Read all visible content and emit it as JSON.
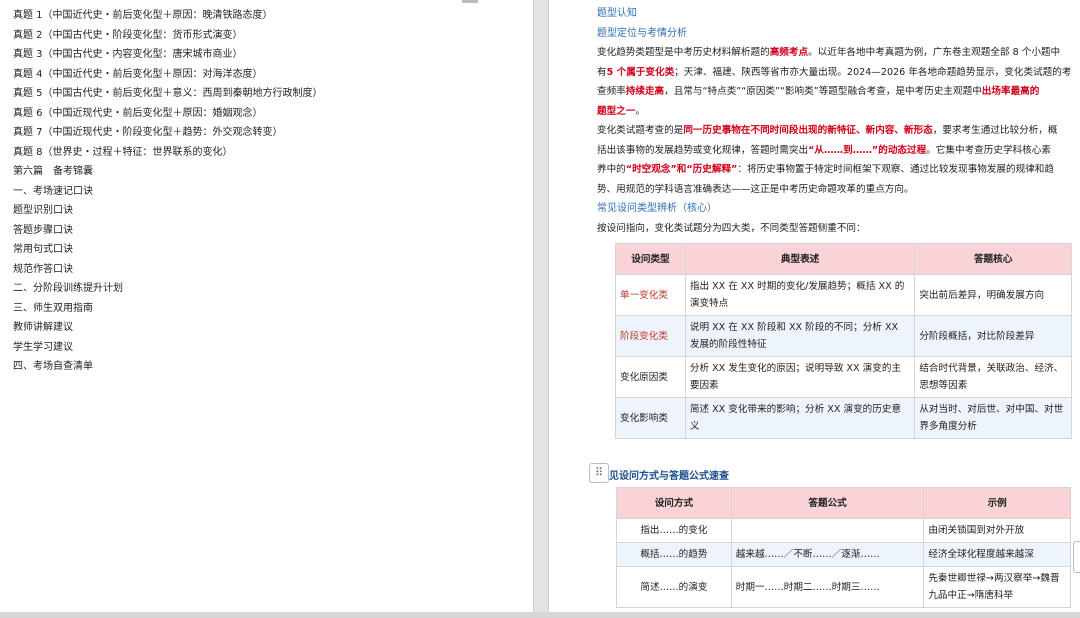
{
  "left_outline": [
    "真题 1（中国近代史・前后变化型＋原因：晚清铁路态度）",
    "真题 2（中国古代史・阶段变化型：货币形式演变）",
    "真题 3（中国古代史・内容变化型：唐宋城市商业）",
    "真题 4（中国近代史・前后变化型＋原因：对海洋态度）",
    "真题 5（中国古代史・前后变化型＋意义：西周到秦朝地方行政制度）",
    "真题 6（中国近现代史・前后变化型＋原因：婚姻观念）",
    "真题 7（中国近现代史・阶段变化型＋趋势：外交观念转变）",
    "真题 8（世界史・过程＋特征：世界联系的变化）",
    "第六篇　备考锦囊",
    "一、考场速记口诀",
    "题型识别口诀",
    "答题步骤口诀",
    "常用句式口诀",
    "规范作答口诀",
    "二、分阶段训练提升计划",
    "三、师生双用指南",
    "教师讲解建议",
    "学生学习建议",
    "四、考场自查清单"
  ],
  "right": {
    "h1": "题型认知",
    "h2": "题型定位与考情分析",
    "p1": {
      "l1a": "变化趋势类题型是中考历史材料解析题的",
      "l1b": "高频考点",
      "l1c": "。以近年各地中考真题为例，广东卷主观题全部 8 个小题中",
      "l2a": "有",
      "l2b": "5 个属于变化类",
      "l2c": "；天津、福建、陕西等省市亦大量出现。2024—2026 年各地命题趋势显示，变化类试题的考",
      "l3a": "查频率",
      "l3b": "持续走高",
      "l3c": "，且常与“特点类”“原因类”“影响类”等题型融合考查，是中考历史主观题中",
      "l3d": "出场率最高的",
      "l4a": "题型之一",
      "l4b": "。"
    },
    "p2": {
      "l1a": "变化类试题考查的是",
      "l1b": "同一历史事物在不同时间段出现的新特征、新内容、新形态",
      "l1c": "，要求考生通过比较分析，概",
      "l2a": "括出该事物的发展趋势或变化规律，答题时需突出",
      "l2b": "“从……到……”的动态过程",
      "l2c": "。它集中考查历史学科核心素",
      "l3a": "养中的",
      "l3b": "“时空观念”和“历史解释”",
      "l3c": "：将历史事物置于特定时间框架下观察、通过比较发现事物发展的规律和趋",
      "l4": "势、用规范的学科语言准确表达——这正是中考历史命题攻革的重点方向。"
    },
    "h3": "常见设问类型辨析（核心）",
    "p3": "按设问指向，变化类试题分为四大类，不同类型答题侧重不同：",
    "table1": {
      "headers": [
        "设问类型",
        "典型表述",
        "答题核心"
      ],
      "rows": [
        [
          "单一变化类",
          "指出 XX 在 XX 时期的变化/发展趋势；概括 XX 的演变特点",
          "突出前后差异，明确发展方向"
        ],
        [
          "阶段变化类",
          "说明 XX 在 XX 阶段和 XX 阶段的不同；分析 XX 发展的阶段性特征",
          "分阶段概括，对比阶段差异"
        ],
        [
          "变化原因类",
          "分析 XX 发生变化的原因；说明导致 XX 演变的主要因素",
          "结合时代背景，关联政治、经济、思想等因素"
        ],
        [
          "变化影响类",
          "简述 XX 变化带来的影响；分析 XX 演变的历史意义",
          "从对当时、对后世、对中国、对世界多角度分析"
        ]
      ]
    },
    "h4": "见设问方式与答题公式速查",
    "table2": {
      "headers": [
        "设问方式",
        "答题公式",
        "示例"
      ],
      "rows": [
        [
          "指出……的变化",
          "",
          "由闭关锁国到对外开放"
        ],
        [
          "概括……的趋势",
          "越来越……／不断……／逐渐……",
          "经济全球化程度越来越深"
        ],
        [
          "简述……的演变",
          "时期一……时期二……时期三……",
          "先秦世卿世禄→两汉察举→魏晋九品中正→隋唐科举"
        ]
      ]
    }
  },
  "icons": {
    "drag": "drag-handle-icon"
  },
  "colors": {
    "heading_blue": "#2e6db4",
    "emphasis_red": "#d0021b",
    "table_header": "#f9d3d6"
  }
}
